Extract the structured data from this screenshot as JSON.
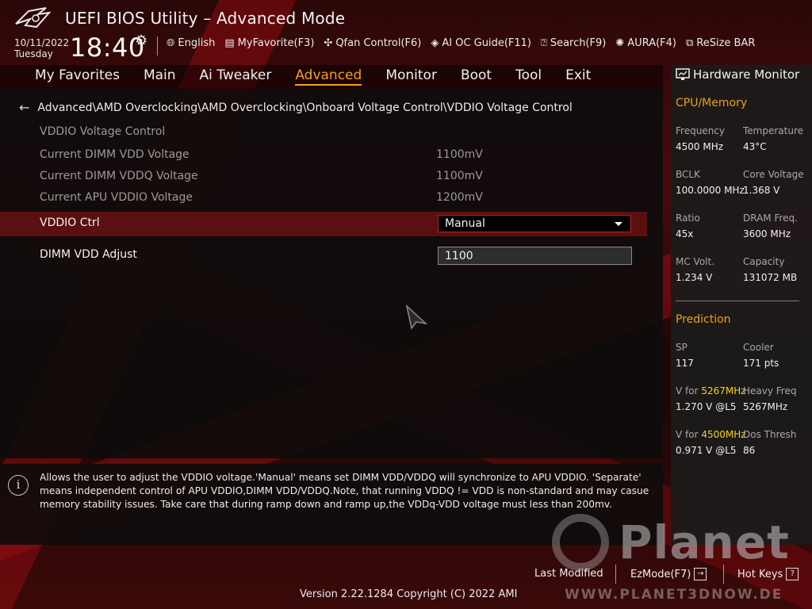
{
  "header": {
    "title": "UEFI BIOS Utility – Advanced Mode",
    "date": "10/11/2022",
    "weekday": "Tuesday",
    "time": "18:40",
    "toolbar": [
      {
        "icon": "globe-icon",
        "label": "English"
      },
      {
        "icon": "favorite-icon",
        "label": "MyFavorite(F3)"
      },
      {
        "icon": "fan-icon",
        "label": "Qfan Control(F6)"
      },
      {
        "icon": "chip-icon",
        "label": "AI OC Guide(F11)"
      },
      {
        "icon": "search-icon",
        "label": "Search(F9)"
      },
      {
        "icon": "light-icon",
        "label": "AURA(F4)"
      },
      {
        "icon": "resize-icon",
        "label": "ReSize BAR"
      }
    ]
  },
  "tabs": [
    "My Favorites",
    "Main",
    "Ai Tweaker",
    "Advanced",
    "Monitor",
    "Boot",
    "Tool",
    "Exit"
  ],
  "active_tab": "Advanced",
  "breadcrumb": "Advanced\\AMD Overclocking\\AMD Overclocking\\Onboard Voltage Control\\VDDIO Voltage Control",
  "settings": {
    "section_title": "VDDIO Voltage Control",
    "readonly": [
      {
        "label": "Current DIMM VDD Voltage",
        "value": "1100mV"
      },
      {
        "label": "Current DIMM VDDQ Voltage",
        "value": "1100mV"
      },
      {
        "label": "Current APU  VDDIO Voltage",
        "value": "1200mV"
      }
    ],
    "vddio_ctrl_label": "VDDIO Ctrl",
    "vddio_ctrl_value": "Manual",
    "dimm_vdd_label": "DIMM VDD Adjust",
    "dimm_vdd_value": "1100"
  },
  "help_text": "Allows the user to adjust the VDDIO voltage.'Manual' means set DIMM VDD/VDDQ will synchronize to APU VDDIO. 'Separate' means independent control of APU VDDIO,DIMM VDD/VDDQ.Note, that running VDDQ != VDD is non-standard and may casue memory stability issues. Take care that during ramp down and ramp up,the VDDq-VDD voltage must less than 200mv.",
  "hardware_monitor": {
    "title": "Hardware Monitor",
    "cpu_section": "CPU/Memory",
    "cpu": {
      "frequency_label": "Frequency",
      "frequency": "4500 MHz",
      "temperature_label": "Temperature",
      "temperature": "43°C",
      "bclk_label": "BCLK",
      "bclk": "100.0000 MHz",
      "core_voltage_label": "Core Voltage",
      "core_voltage": "1.368 V",
      "ratio_label": "Ratio",
      "ratio": "45x",
      "dram_freq_label": "DRAM Freq.",
      "dram_freq": "3600 MHz",
      "mc_volt_label": "MC Volt.",
      "mc_volt": "1.234 V",
      "capacity_label": "Capacity",
      "capacity": "131072 MB"
    },
    "prediction_section": "Prediction",
    "prediction": {
      "sp_label": "SP",
      "sp": "117",
      "cooler_label": "Cooler",
      "cooler": "171 pts",
      "v_for_prefix": "V for ",
      "v_for_1_freq": "5267MHz",
      "v_for_1": "1.270 V @L5",
      "heavy_freq_label": "Heavy Freq",
      "heavy_freq": "5267MHz",
      "v_for_2_freq": "4500MHz",
      "v_for_2": "0.971 V @L5",
      "dos_thresh_label": "Dos Thresh",
      "dos_thresh": "86"
    }
  },
  "footer": {
    "last_modified": "Last Modified",
    "ezmode": "EzMode(F7)",
    "hot_keys": "Hot Keys",
    "hot_keys_key": "?",
    "version": "Version 2.22.1284 Copyright (C) 2022 AMI"
  },
  "watermark": {
    "brand": "Planet",
    "url": "WWW.PLANET3DNOW.DE"
  },
  "colors": {
    "accent": "#f0a020",
    "selected_row": "#5a1010",
    "highlight_freq": "#f2d21c"
  }
}
